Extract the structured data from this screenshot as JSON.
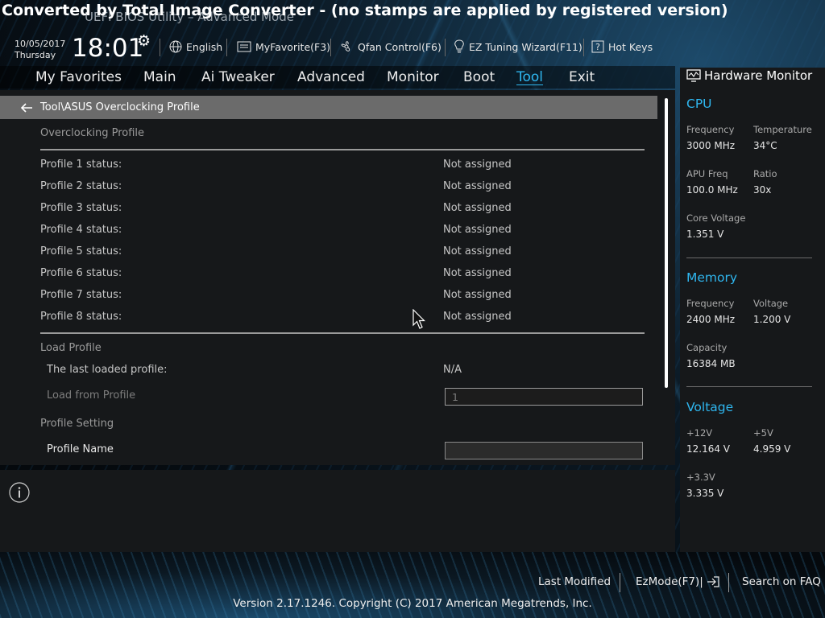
{
  "watermark": "Converted by Total Image Converter - (no stamps are applied by registered version)",
  "window_title": "UEFI BIOS Utility – Advanced Mode",
  "topbar": {
    "date": "10/05/2017",
    "day": "Thursday",
    "time": "18:01",
    "language": "English",
    "my_favorite": "MyFavorite(F3)",
    "qfan": "Qfan Control(F6)",
    "ez_tuning": "EZ Tuning Wizard(F11)",
    "hot_keys": "Hot Keys"
  },
  "tabs": [
    {
      "label": "My Favorites"
    },
    {
      "label": "Main"
    },
    {
      "label": "Ai Tweaker"
    },
    {
      "label": "Advanced"
    },
    {
      "label": "Monitor"
    },
    {
      "label": "Boot"
    },
    {
      "label": "Tool"
    },
    {
      "label": "Exit"
    }
  ],
  "active_tab": "Tool",
  "breadcrumb": "Tool\\ASUS Overclocking Profile",
  "main": {
    "overclocking_profile_title": "Overclocking Profile",
    "profiles": [
      {
        "label": "Profile 1 status:",
        "value": "Not assigned"
      },
      {
        "label": "Profile 2 status:",
        "value": "Not assigned"
      },
      {
        "label": "Profile 3 status:",
        "value": "Not assigned"
      },
      {
        "label": "Profile 4 status:",
        "value": "Not assigned"
      },
      {
        "label": "Profile 5 status:",
        "value": "Not assigned"
      },
      {
        "label": "Profile 6 status:",
        "value": "Not assigned"
      },
      {
        "label": "Profile 7 status:",
        "value": "Not assigned"
      },
      {
        "label": "Profile 8 status:",
        "value": "Not assigned"
      }
    ],
    "load_profile_title": "Load Profile",
    "last_loaded_label": "The last loaded profile:",
    "last_loaded_value": "N/A",
    "load_from_label": "Load from Profile",
    "load_from_value": "1",
    "profile_setting_title": "Profile Setting",
    "profile_name_label": "Profile Name",
    "profile_name_value": ""
  },
  "hardware_monitor": {
    "title": "Hardware Monitor",
    "cpu": {
      "title": "CPU",
      "frequency_label": "Frequency",
      "frequency": "3000 MHz",
      "temperature_label": "Temperature",
      "temperature": "34°C",
      "apu_freq_label": "APU Freq",
      "apu_freq": "100.0 MHz",
      "ratio_label": "Ratio",
      "ratio": "30x",
      "core_voltage_label": "Core Voltage",
      "core_voltage": "1.351 V"
    },
    "memory": {
      "title": "Memory",
      "frequency_label": "Frequency",
      "frequency": "2400 MHz",
      "voltage_label": "Voltage",
      "voltage": "1.200 V",
      "capacity_label": "Capacity",
      "capacity": "16384 MB"
    },
    "voltage": {
      "title": "Voltage",
      "v12_label": "+12V",
      "v12": "12.164 V",
      "v5_label": "+5V",
      "v5": "4.959 V",
      "v33_label": "+3.3V",
      "v33": "3.335 V"
    }
  },
  "bottom": {
    "last_modified": "Last Modified",
    "ezmode": "EzMode(F7)|",
    "search_faq": "Search on FAQ",
    "version": "Version 2.17.1246. Copyright (C) 2017 American Megatrends, Inc."
  },
  "colors": {
    "accent": "#2fb7f0",
    "panel": "#16181a",
    "breadcrumb_bar": "#6b6b6b"
  }
}
